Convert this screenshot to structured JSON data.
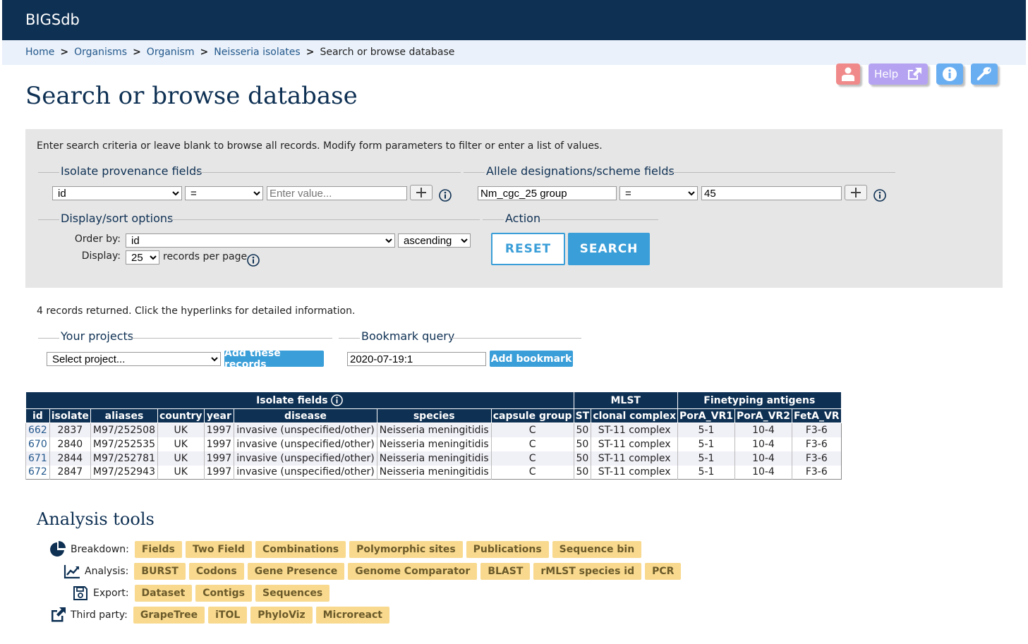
{
  "header": {
    "brand": "BIGSdb"
  },
  "breadcrumb": {
    "items": [
      "Home",
      "Organisms",
      "Organism",
      "Neisseria isolates"
    ],
    "current": "Search or browse database"
  },
  "utility": {
    "help_label": "Help"
  },
  "page_title": "Search or browse database",
  "search_panel": {
    "intro": "Enter search criteria or leave blank to browse all records. Modify form parameters to filter or enter a list of values.",
    "provenance": {
      "legend": "Isolate provenance fields",
      "field": "id",
      "operator": "=",
      "value_placeholder": "Enter value..."
    },
    "allele": {
      "legend": "Allele designations/scheme fields",
      "field": "Nm_cgc_25 group",
      "operator": "=",
      "value": "45"
    },
    "display": {
      "legend": "Display/sort options",
      "order_by_label": "Order by:",
      "order_by": "id",
      "direction": "ascending",
      "display_label": "Display:",
      "per_page": "25",
      "per_page_suffix": "records per page"
    },
    "action": {
      "legend": "Action",
      "reset": "RESET",
      "search": "SEARCH"
    }
  },
  "results_summary": "4 records returned. Click the hyperlinks for detailed information.",
  "projects": {
    "legend": "Your projects",
    "select": "Select project...",
    "button": "Add these records"
  },
  "bookmark": {
    "legend": "Bookmark query",
    "value": "2020-07-19:1",
    "button": "Add bookmark"
  },
  "table": {
    "groups": [
      "Isolate fields",
      "MLST",
      "Finetyping antigens"
    ],
    "columns": [
      "id",
      "isolate",
      "aliases",
      "country",
      "year",
      "disease",
      "species",
      "capsule group",
      "ST",
      "clonal complex",
      "PorA_VR1",
      "PorA_VR2",
      "FetA_VR"
    ],
    "rows": [
      [
        "662",
        "2837",
        "M97/252508",
        "UK",
        "1997",
        "invasive (unspecified/other)",
        "Neisseria meningitidis",
        "C",
        "50",
        "ST-11 complex",
        "5-1",
        "10-4",
        "F3-6"
      ],
      [
        "670",
        "2840",
        "M97/252535",
        "UK",
        "1997",
        "invasive (unspecified/other)",
        "Neisseria meningitidis",
        "C",
        "50",
        "ST-11 complex",
        "5-1",
        "10-4",
        "F3-6"
      ],
      [
        "671",
        "2844",
        "M97/252781",
        "UK",
        "1997",
        "invasive (unspecified/other)",
        "Neisseria meningitidis",
        "C",
        "50",
        "ST-11 complex",
        "5-1",
        "10-4",
        "F3-6"
      ],
      [
        "672",
        "2847",
        "M97/252943",
        "UK",
        "1997",
        "invasive (unspecified/other)",
        "Neisseria meningitidis",
        "C",
        "50",
        "ST-11 complex",
        "5-1",
        "10-4",
        "F3-6"
      ]
    ]
  },
  "analysis_tools": {
    "title": "Analysis tools",
    "rows": [
      {
        "label": "Breakdown:",
        "icon": "pie-chart-icon",
        "tools": [
          "Fields",
          "Two Field",
          "Combinations",
          "Polymorphic sites",
          "Publications",
          "Sequence bin"
        ]
      },
      {
        "label": "Analysis:",
        "icon": "line-chart-icon",
        "tools": [
          "BURST",
          "Codons",
          "Gene Presence",
          "Genome Comparator",
          "BLAST",
          "rMLST species id",
          "PCR"
        ]
      },
      {
        "label": "Export:",
        "icon": "save-icon",
        "tools": [
          "Dataset",
          "Contigs",
          "Sequences"
        ]
      },
      {
        "label": "Third party:",
        "icon": "external-link-icon",
        "tools": [
          "GrapeTree",
          "iTOL",
          "PhyloViz",
          "Microreact"
        ]
      }
    ]
  },
  "colors": {
    "navy": "#0e3053",
    "accent": "#3a9ed8",
    "chip": "#f8d98e",
    "link": "#23588c"
  }
}
